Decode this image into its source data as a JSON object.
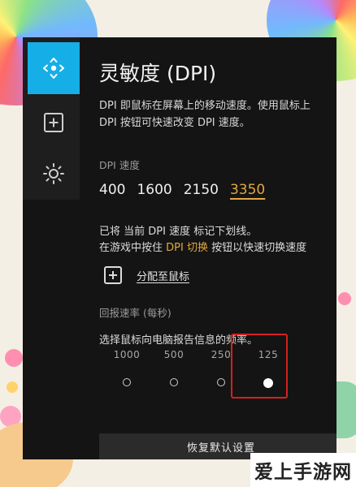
{
  "page": {
    "title": "灵敏度 (DPI)",
    "description_line1": "DPI 即鼠标在屏幕上的移动速度。使用鼠标上",
    "description_line2": "DPI 按钮可快速改变 DPI 速度。"
  },
  "sidebar": {
    "items": [
      {
        "icon": "move-icon",
        "active": true
      },
      {
        "icon": "add-square-icon",
        "active": false
      },
      {
        "icon": "brightness-icon",
        "active": false
      }
    ]
  },
  "dpi": {
    "label": "DPI 速度",
    "values": [
      "400",
      "1600",
      "2150",
      "3350"
    ],
    "current": "3350",
    "note_line1": "已将 当前 DPI 速度 标记下划线。",
    "note_line2_pre": "在游戏中按住 ",
    "note_line2_hl": "DPI 切换",
    "note_line2_post": " 按钮以快速切换速度",
    "assign_label": "分配至鼠标"
  },
  "report_rate": {
    "label": "回报速率 (每秒)",
    "description": "选择鼠标向电脑报告信息的频率。",
    "options": [
      "1000",
      "500",
      "250",
      "125"
    ],
    "selected": "125"
  },
  "reset_button": "恢复默认设置",
  "watermark": "爱上手游网",
  "colors": {
    "accent_blue": "#16aee6",
    "current_dpi": "#e2a83f",
    "highlight_box": "#d81f1f"
  }
}
